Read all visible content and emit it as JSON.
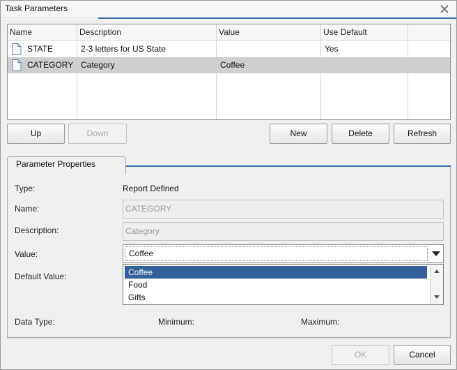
{
  "window": {
    "title": "Task Parameters"
  },
  "table": {
    "headers": [
      "Name",
      "Description",
      "Value",
      "Use Default"
    ],
    "rows": [
      {
        "name": "STATE",
        "description": "2-3 letters for US State",
        "value": "",
        "use_default": "Yes",
        "selected": false
      },
      {
        "name": "CATEGORY",
        "description": "Category",
        "value": "Coffee",
        "use_default": "",
        "selected": true
      }
    ]
  },
  "buttons": {
    "up": "Up",
    "down": "Down",
    "new": "New",
    "delete": "Delete",
    "refresh": "Refresh",
    "ok": "OK",
    "cancel": "Cancel"
  },
  "properties": {
    "group_title": "Parameter Properties",
    "type_label": "Type:",
    "type_value": "Report Defined",
    "name_label": "Name:",
    "name_value": "CATEGORY",
    "description_label": "Description:",
    "description_value": "Category",
    "value_label": "Value:",
    "value_selected": "Coffee",
    "default_value_label": "Default Value:",
    "options": [
      "Coffee",
      "Food",
      "Gifts"
    ],
    "data_type_label": "Data Type:",
    "minimum_label": "Minimum:",
    "maximum_label": "Maximum:"
  },
  "colors": {
    "accent": "#3d6ea8",
    "selection": "#33609a",
    "row_selected": "#cfcfcf"
  }
}
